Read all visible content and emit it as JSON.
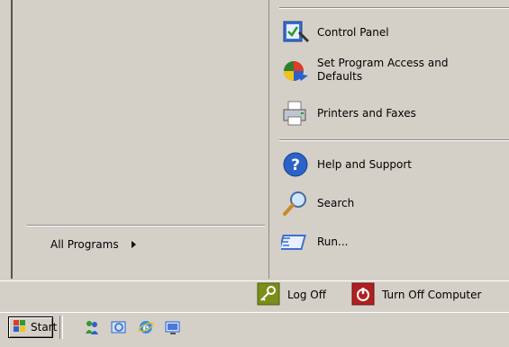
{
  "left": {
    "all_programs_label": "All Programs"
  },
  "right": {
    "items": [
      {
        "label": "Control Panel",
        "icon": "control-panel-icon"
      },
      {
        "label": "Set Program Access and Defaults",
        "icon": "program-access-icon"
      },
      {
        "label": "Printers and Faxes",
        "icon": "printers-faxes-icon"
      },
      {
        "label": "Help and Support",
        "icon": "help-icon"
      },
      {
        "label": "Search",
        "icon": "search-icon"
      },
      {
        "label": "Run...",
        "icon": "run-icon"
      }
    ]
  },
  "bottom": {
    "logoff_label": "Log Off",
    "turnoff_label": "Turn Off Computer"
  },
  "taskbar": {
    "start_label": "Start",
    "quicklaunch": [
      "messenger-icon",
      "outlook-express-icon",
      "internet-explorer-icon",
      "show-desktop-icon"
    ]
  },
  "colors": {
    "face": "#d4d0c8",
    "shadow": "#8a8a8a",
    "logoff": "#7a8f1a",
    "turnoff": "#b02020"
  }
}
